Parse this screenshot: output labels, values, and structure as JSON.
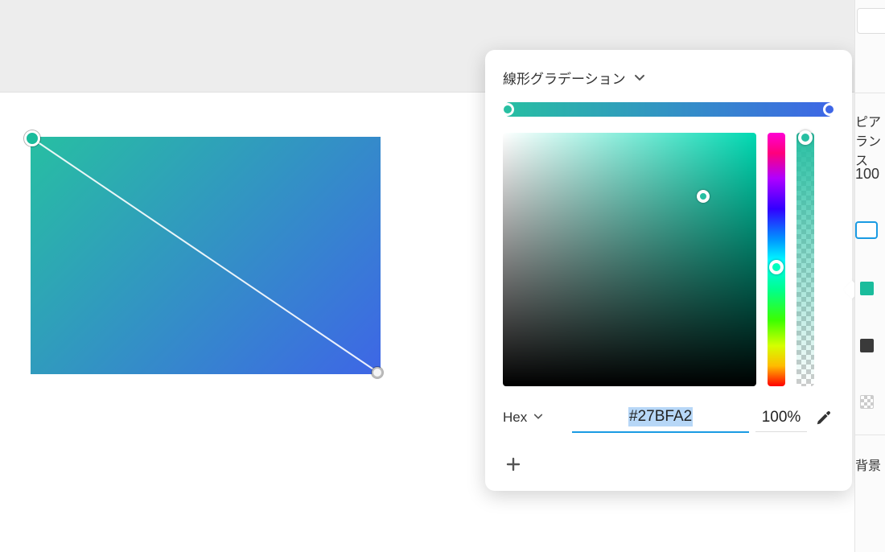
{
  "popup": {
    "title": "線形グラデーション",
    "format_label": "Hex",
    "hex_value": "#27BFA2",
    "opacity_value": "100%"
  },
  "gradient": {
    "start_color": "#27BFA2",
    "end_color": "#3E66E6"
  },
  "right_panel": {
    "appearance_label": "ピアランス",
    "opacity_value": "100",
    "background_label": "背景"
  },
  "icons": {
    "chevron": "chevron-down-icon",
    "eyedropper": "eyedropper-icon",
    "plus": "plus-icon"
  }
}
